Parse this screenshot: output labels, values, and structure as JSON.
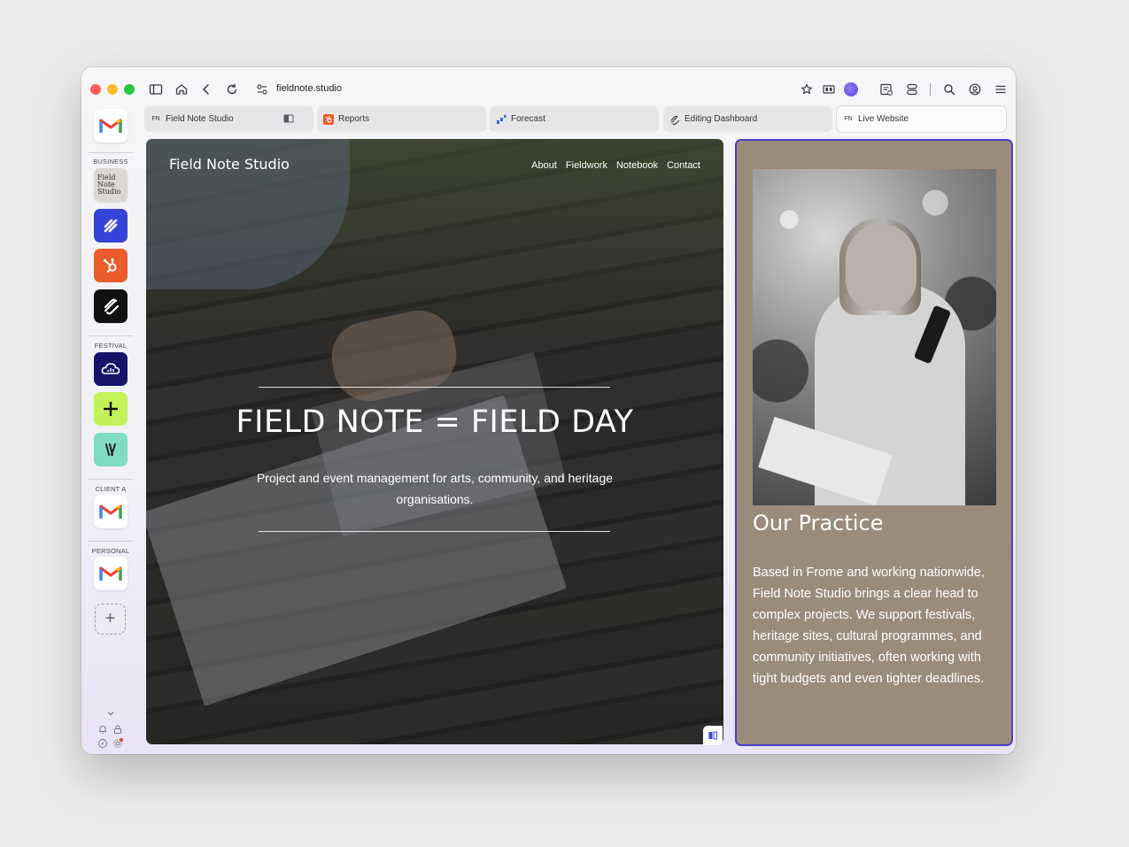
{
  "browser": {
    "url": "fieldnote.studio",
    "tabs": [
      {
        "label": "Field Note Studio",
        "favicon": "FN",
        "active": false
      },
      {
        "label": "Reports",
        "favicon": "hubspot-icon",
        "active": false
      },
      {
        "label": "Forecast",
        "favicon": "forecast-icon",
        "active": false
      },
      {
        "label": "Editing Dashboard",
        "favicon": "squarespace-icon",
        "active": false
      },
      {
        "label": "Live Website",
        "favicon": "FN",
        "active": true
      }
    ]
  },
  "sidebar": {
    "sections": [
      {
        "label": "BUSINESS"
      },
      {
        "label": "FESTIVAL"
      },
      {
        "label": "CLIENT A"
      },
      {
        "label": "PERSONAL"
      }
    ],
    "fns_tile": "Field Note Studio",
    "apps": [
      "gmail-icon",
      "field-note-studio-icon",
      "forecast-icon",
      "hubspot-icon",
      "squarespace-icon",
      "cloud-icon",
      "plus-app-icon",
      "slash-app-icon",
      "gmail-icon",
      "gmail-icon"
    ]
  },
  "site": {
    "title": "Field Note Studio",
    "nav": [
      "About",
      "Fieldwork",
      "Notebook",
      "Contact"
    ],
    "headline": "FIELD NOTE = FIELD DAY",
    "subheadline": "Project and event management for arts, community, and heritage organisations."
  },
  "practice": {
    "title": "Our Practice",
    "body": "Based in Frome and working nationwide, Field Note Studio brings a clear head to complex projects. We support festivals, heritage sites, cultural programmes, and community initiatives, often working with tight budgets and even tighter deadlines."
  },
  "colors": {
    "accent": "#4b3fc8",
    "practice_bg": "#9b8b7a",
    "gmail_red": "#ea4335"
  }
}
